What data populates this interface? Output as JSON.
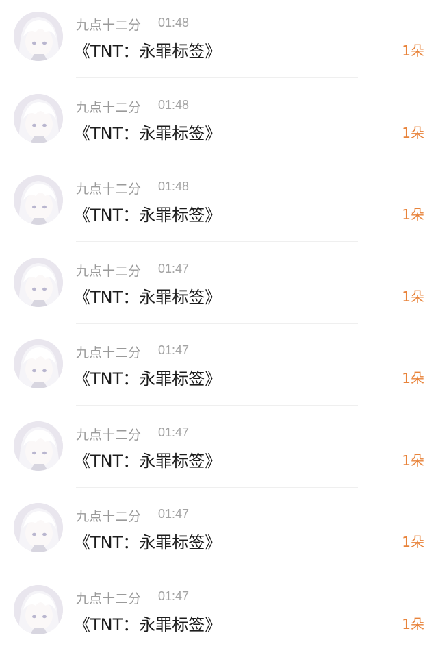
{
  "gift_list": {
    "items": [
      {
        "sender": "九点十二分",
        "time": "01:48",
        "gift": "《TNT：永罪标签》",
        "amount": "1朵",
        "avatar": "anime-avatar"
      },
      {
        "sender": "九点十二分",
        "time": "01:48",
        "gift": "《TNT：永罪标签》",
        "amount": "1朵",
        "avatar": "anime-avatar"
      },
      {
        "sender": "九点十二分",
        "time": "01:48",
        "gift": "《TNT：永罪标签》",
        "amount": "1朵",
        "avatar": "anime-avatar"
      },
      {
        "sender": "九点十二分",
        "time": "01:47",
        "gift": "《TNT：永罪标签》",
        "amount": "1朵",
        "avatar": "anime-avatar"
      },
      {
        "sender": "九点十二分",
        "time": "01:47",
        "gift": "《TNT：永罪标签》",
        "amount": "1朵",
        "avatar": "anime-avatar"
      },
      {
        "sender": "九点十二分",
        "time": "01:47",
        "gift": "《TNT：永罪标签》",
        "amount": "1朵",
        "avatar": "anime-avatar"
      },
      {
        "sender": "九点十二分",
        "time": "01:47",
        "gift": "《TNT：永罪标签》",
        "amount": "1朵",
        "avatar": "anime-avatar"
      },
      {
        "sender": "九点十二分",
        "time": "01:47",
        "gift": "《TNT：永罪标签》",
        "amount": "1朵",
        "avatar": "anime-avatar"
      }
    ]
  },
  "colors": {
    "amount": "#e8833a",
    "sender": "#9a9a9a",
    "title": "#1d1d1d",
    "divider": "#efefef"
  }
}
